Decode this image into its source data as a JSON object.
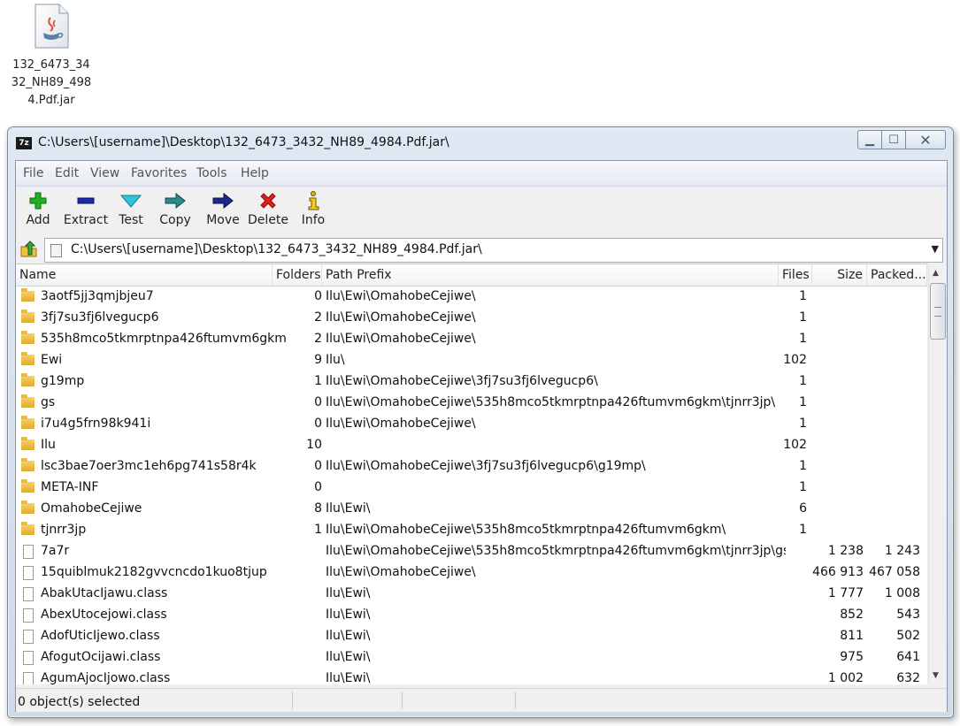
{
  "desktop_icon": {
    "label_lines": [
      "132_6473_34",
      "32_NH89_498",
      "4.Pdf.jar"
    ],
    "icon": "java-jar-file-icon"
  },
  "window": {
    "app_icon_text": "7z",
    "title": "C:\\Users\\[username]\\Desktop\\132_6473_3432_NH89_4984.Pdf.jar\\",
    "min_glyph": "▁",
    "max_glyph": "☐",
    "close_glyph": "✕"
  },
  "menu": [
    "File",
    "Edit",
    "View",
    "Favorites",
    "Tools",
    "Help"
  ],
  "toolbar": [
    {
      "label": "Add",
      "icon": "plus-icon",
      "color": "#1aa31a"
    },
    {
      "label": "Extract",
      "icon": "minus-icon",
      "color": "#1a2aa8"
    },
    {
      "label": "Test",
      "icon": "check-icon",
      "color": "#1ab0c8"
    },
    {
      "label": "Copy",
      "icon": "copy-arrow-icon",
      "color": "#2a8a8a"
    },
    {
      "label": "Move",
      "icon": "move-arrow-icon",
      "color": "#1a2a8a"
    },
    {
      "label": "Delete",
      "icon": "delete-x-icon",
      "color": "#d81c1c"
    },
    {
      "label": "Info",
      "icon": "info-icon",
      "color": "#c8a800"
    }
  ],
  "address": {
    "path": "C:\\Users\\[username]\\Desktop\\132_6473_3432_NH89_4984.Pdf.jar\\",
    "dropdown_glyph": "▼"
  },
  "columns": {
    "name": "Name",
    "folders": "Folders",
    "prefix": "Path Prefix",
    "files": "Files",
    "size": "Size",
    "packed": "Packed..."
  },
  "rows": [
    {
      "type": "folder",
      "name": "3aotf5jj3qmjbjeu7",
      "folders": "0",
      "prefix": "Ilu\\Ewi\\OmahobeCejiwe\\",
      "files": "1",
      "size": "",
      "packed": ""
    },
    {
      "type": "folder",
      "name": "3fj7su3fj6lvegucp6",
      "folders": "2",
      "prefix": "Ilu\\Ewi\\OmahobeCejiwe\\",
      "files": "1",
      "size": "",
      "packed": ""
    },
    {
      "type": "folder",
      "name": "535h8mco5tkmrptnpa426ftumvm6gkm",
      "folders": "2",
      "prefix": "Ilu\\Ewi\\OmahobeCejiwe\\",
      "files": "1",
      "size": "",
      "packed": ""
    },
    {
      "type": "folder",
      "name": "Ewi",
      "folders": "9",
      "prefix": "Ilu\\",
      "files": "102",
      "size": "",
      "packed": ""
    },
    {
      "type": "folder",
      "name": "g19mp",
      "folders": "1",
      "prefix": "Ilu\\Ewi\\OmahobeCejiwe\\3fj7su3fj6lvegucp6\\",
      "files": "1",
      "size": "",
      "packed": ""
    },
    {
      "type": "folder",
      "name": "gs",
      "folders": "0",
      "prefix": "Ilu\\Ewi\\OmahobeCejiwe\\535h8mco5tkmrptnpa426ftumvm6gkm\\tjnrr3jp\\",
      "files": "1",
      "size": "",
      "packed": ""
    },
    {
      "type": "folder",
      "name": "i7u4g5frn98k941i",
      "folders": "0",
      "prefix": "Ilu\\Ewi\\OmahobeCejiwe\\",
      "files": "1",
      "size": "",
      "packed": ""
    },
    {
      "type": "folder",
      "name": "Ilu",
      "folders": "10",
      "prefix": "",
      "files": "102",
      "size": "",
      "packed": ""
    },
    {
      "type": "folder",
      "name": "lsc3bae7oer3mc1eh6pg741s58r4k",
      "folders": "0",
      "prefix": "Ilu\\Ewi\\OmahobeCejiwe\\3fj7su3fj6lvegucp6\\g19mp\\",
      "files": "1",
      "size": "",
      "packed": ""
    },
    {
      "type": "folder",
      "name": "META-INF",
      "folders": "0",
      "prefix": "",
      "files": "1",
      "size": "",
      "packed": ""
    },
    {
      "type": "folder",
      "name": "OmahobeCejiwe",
      "folders": "8",
      "prefix": "Ilu\\Ewi\\",
      "files": "6",
      "size": "",
      "packed": ""
    },
    {
      "type": "folder",
      "name": "tjnrr3jp",
      "folders": "1",
      "prefix": "Ilu\\Ewi\\OmahobeCejiwe\\535h8mco5tkmrptnpa426ftumvm6gkm\\",
      "files": "1",
      "size": "",
      "packed": ""
    },
    {
      "type": "file",
      "name": "7a7r",
      "folders": "",
      "prefix": "Ilu\\Ewi\\OmahobeCejiwe\\535h8mco5tkmrptnpa426ftumvm6gkm\\tjnrr3jp\\gs\\",
      "files": "",
      "size": "1 238",
      "packed": "1 243"
    },
    {
      "type": "file",
      "name": "15quiblmuk2182gvvcncdo1kuo8tjup",
      "folders": "",
      "prefix": "Ilu\\Ewi\\OmahobeCejiwe\\",
      "files": "",
      "size": "466 913",
      "packed": "467 058"
    },
    {
      "type": "file",
      "name": "AbakUtacIjawu.class",
      "folders": "",
      "prefix": "Ilu\\Ewi\\",
      "files": "",
      "size": "1 777",
      "packed": "1 008"
    },
    {
      "type": "file",
      "name": "AbexUtocejowi.class",
      "folders": "",
      "prefix": "Ilu\\Ewi\\",
      "files": "",
      "size": "852",
      "packed": "543"
    },
    {
      "type": "file",
      "name": "AdofUticIjewo.class",
      "folders": "",
      "prefix": "Ilu\\Ewi\\",
      "files": "",
      "size": "811",
      "packed": "502"
    },
    {
      "type": "file",
      "name": "AfogutOcijawi.class",
      "folders": "",
      "prefix": "Ilu\\Ewi\\",
      "files": "",
      "size": "975",
      "packed": "641"
    },
    {
      "type": "file",
      "name": "AgumAjocIjowo.class",
      "folders": "",
      "prefix": "Ilu\\Ewi\\",
      "files": "",
      "size": "1 002",
      "packed": "632"
    }
  ],
  "status": {
    "selected": "0 object(s) selected"
  }
}
